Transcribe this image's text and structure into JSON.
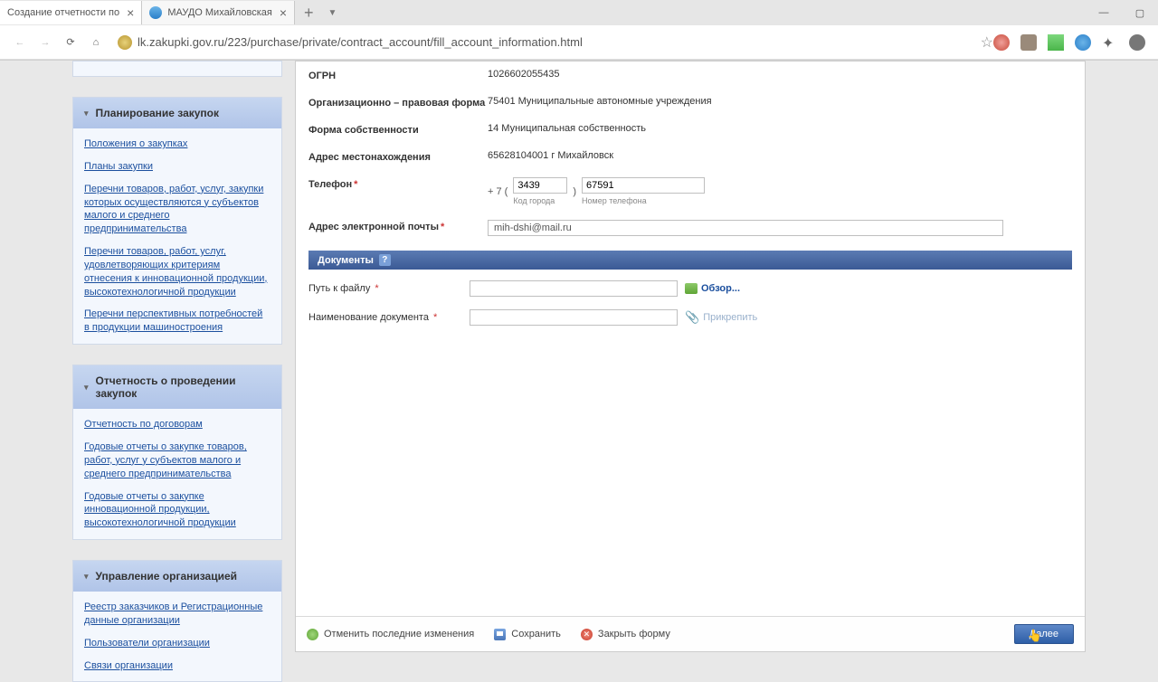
{
  "browser": {
    "tabs": [
      {
        "title": "Создание отчетности по",
        "active": true
      },
      {
        "title": "МАУДО Михайловская"
      }
    ],
    "url": "lk.zakupki.gov.ru/223/purchase/private/contract_account/fill_account_information.html"
  },
  "sidebar": {
    "sections": [
      {
        "title": "Планирование закупок",
        "links": [
          "Положения о закупках",
          "Планы закупки",
          "Перечни товаров, работ, услуг, закупки которых осуществляются у субъектов малого и среднего предпринимательства",
          "Перечни товаров, работ, услуг, удовлетворяющих критериям отнесения к инновационной продукции, высокотехнологичной продукции",
          "Перечни перспективных потребностей в продукции машиностроения"
        ]
      },
      {
        "title": "Отчетность о проведении закупок",
        "links": [
          "Отчетность по договорам",
          "Годовые отчеты о закупке товаров, работ, услуг у субъектов малого и среднего предпринимательства",
          "Годовые отчеты о закупке инновационной продукции, высокотехнологичной продукции"
        ]
      },
      {
        "title": "Управление организацией",
        "links": [
          "Реестр заказчиков и Регистрационные данные организации",
          "Пользователи организации",
          "Связи организации"
        ]
      }
    ]
  },
  "form": {
    "ogrn": {
      "label": "ОГРН",
      "value": "1026602055435"
    },
    "orgform": {
      "label": "Организационно – правовая форма",
      "value": "75401 Муниципальные автономные учреждения"
    },
    "ownership": {
      "label": "Форма собственности",
      "value": "14 Муниципальная собственность"
    },
    "address": {
      "label": "Адрес местонахождения",
      "value": "65628104001 г Михайловск"
    },
    "phone": {
      "label": "Телефон",
      "prefix": "+ 7 (",
      "code": "3439",
      "mid": ")",
      "number": "67591",
      "hint_code": "Код города",
      "hint_num": "Номер телефона"
    },
    "email": {
      "label": "Адрес электронной почты",
      "value": "mih-dshi@mail.ru"
    },
    "docs_header": "Документы",
    "file_path": {
      "label": "Путь к файлу",
      "browse": "Обзор..."
    },
    "doc_name": {
      "label": "Наименование документа",
      "attach": "Прикрепить"
    }
  },
  "footer": {
    "undo": "Отменить последние изменения",
    "save": "Сохранить",
    "close": "Закрыть форму",
    "next": "Далее"
  }
}
